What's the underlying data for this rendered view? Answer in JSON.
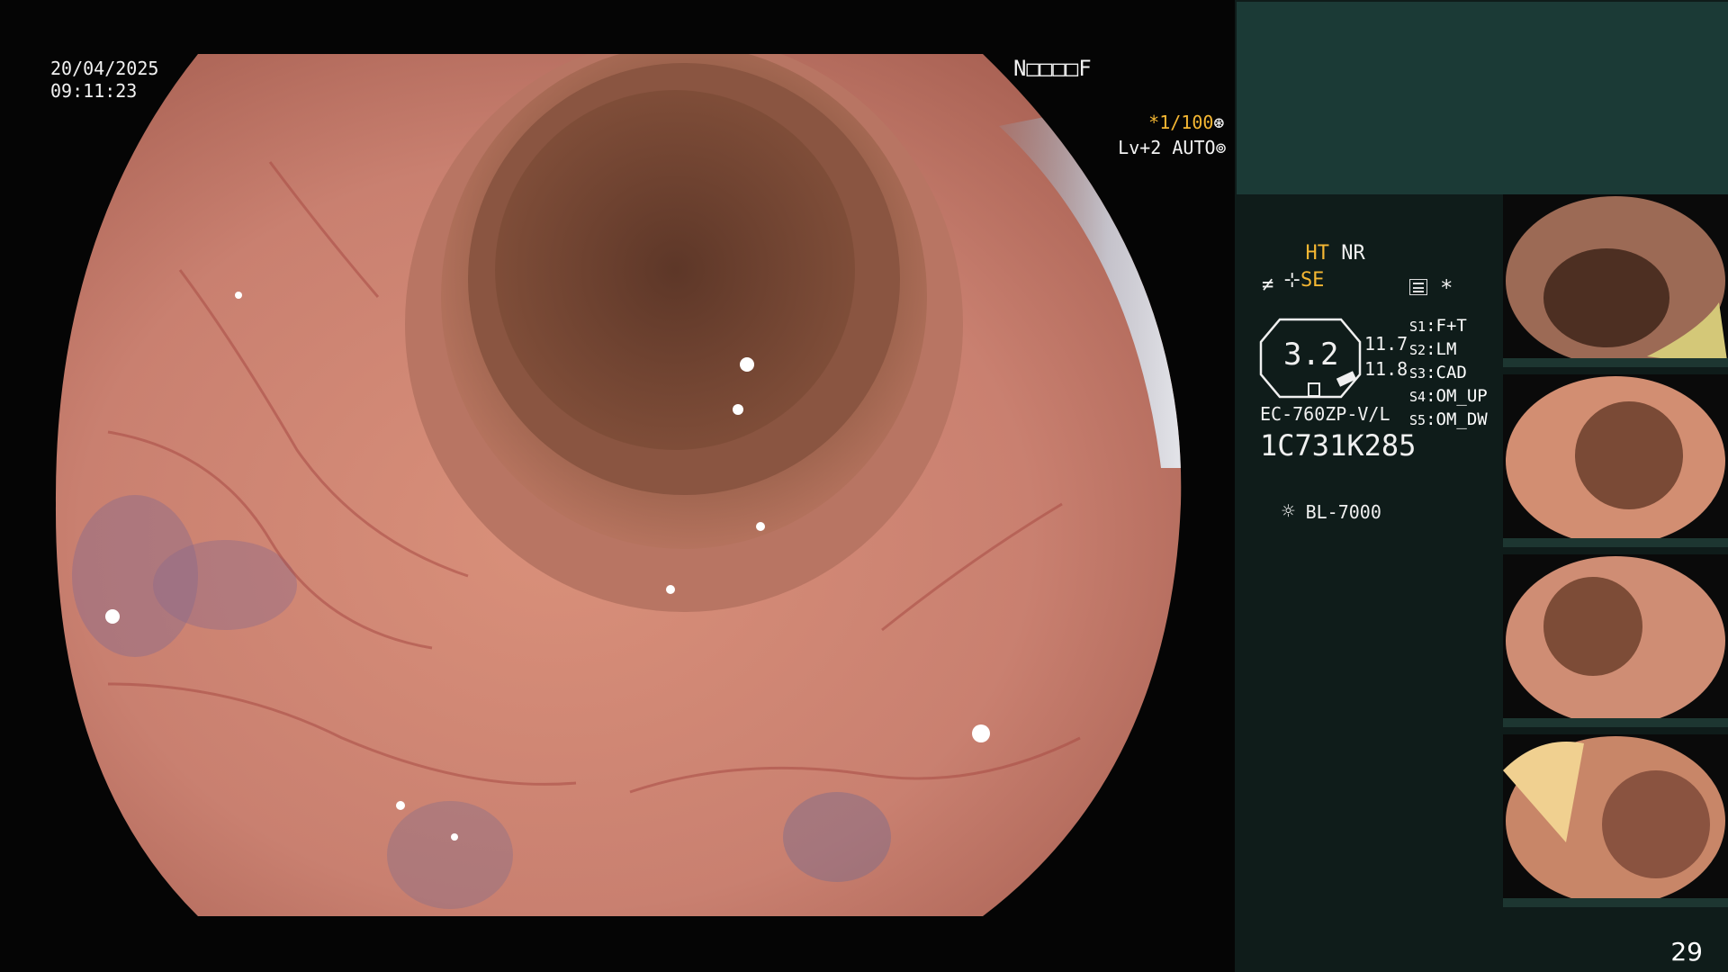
{
  "overlay": {
    "date": "20/04/2025",
    "time": "09:11:23",
    "patient_code": "N□□□□F",
    "shutter": "*1/100",
    "shutter_icon": "aperture-icon",
    "level": "Lv+2 AUTO",
    "level_icon": "iris-icon"
  },
  "panel": {
    "ht": "HT",
    "nr": "NR",
    "se_prefix": "⊹",
    "se": "SE",
    "filter_symbol": "≠",
    "menu_icon": "settings-list-icon",
    "asterisk": "*",
    "zoom_value": "3.2",
    "value_a": "11.7",
    "value_b": "11.8",
    "scope_model": "EC-760ZP-V/L",
    "scope_serial": "1C731K285",
    "light_icon": "sun-icon",
    "light_source": "BL-7000",
    "presets": [
      {
        "key": "S1",
        "value": "F+T"
      },
      {
        "key": "S2",
        "value": "LM"
      },
      {
        "key": "S3",
        "value": "CAD"
      },
      {
        "key": "S4",
        "value": "OM_UP"
      },
      {
        "key": "S5",
        "value": "OM_DW"
      }
    ]
  },
  "thumbnails": [
    "thumbnail-1",
    "thumbnail-2",
    "thumbnail-3",
    "thumbnail-4"
  ],
  "page_number": "29",
  "colors": {
    "panel_bg": "#0f1c1a",
    "panel_header": "#1b3a36",
    "accent_yellow": "#f5b733",
    "mucosa": "#c9826e"
  }
}
